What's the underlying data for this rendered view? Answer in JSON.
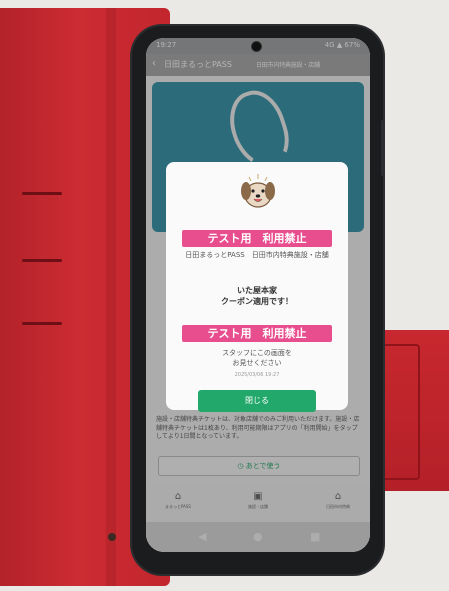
{
  "status": {
    "time": "19:27",
    "right": "4G ▲ 67%"
  },
  "header": {
    "back": "‹",
    "title": "日田まるっとPASS",
    "subtitle": "日田市内特典施設・店舗"
  },
  "modal": {
    "banner_top": "テスト用　利用禁止",
    "store_line": "日田まるっとPASS　日田市内特典施設・店舗",
    "shop_name": "いた屋本家",
    "coupon_applied": "クーポン適用です！",
    "banner_bottom": "テスト用　利用禁止",
    "staff_line1": "スタッフにこの画面を",
    "staff_line2": "お見せください",
    "datetime": "2025/03/06 19:27",
    "close_label": "閉じる"
  },
  "notice": "施設・店舗特典チケットは、対象店舗でのみご利用いただけます。施設・店舗特典チケットは1枚あり、利用可能期限はアプリの「利用開始」をタップしてより1日間となっています。",
  "later_label": "あとで使う",
  "tabs": [
    {
      "icon": "ticket-icon",
      "label": "まるっとPASS"
    },
    {
      "icon": "coupon-icon",
      "label": "施設・店舗"
    },
    {
      "icon": "shop-icon",
      "label": "日田市内特典"
    }
  ],
  "nav": {
    "back": "◀",
    "home": "●",
    "recents": "■"
  },
  "colors": {
    "accent_green": "#21a86a",
    "banner_pink": "#e84e8e",
    "hero_teal": "#2d8fa6",
    "case_red": "#c3262e"
  }
}
